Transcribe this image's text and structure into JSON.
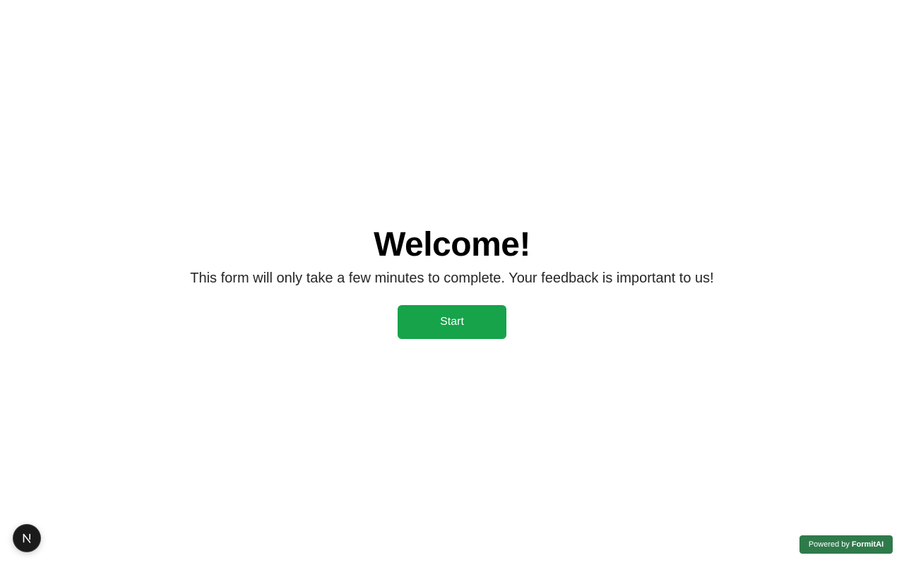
{
  "welcome": {
    "title": "Welcome!",
    "subtitle": "This form will only take a few minutes to complete. Your feedback is important to us!",
    "start_label": "Start"
  },
  "footer": {
    "powered_prefix": "Powered by",
    "powered_brand": "FormitAI"
  },
  "icons": {
    "dev_badge": "nextjs-n-icon"
  },
  "colors": {
    "accent": "#16a34a",
    "powered_badge": "#2f7a4b",
    "dev_badge": "#1a1a1a"
  }
}
